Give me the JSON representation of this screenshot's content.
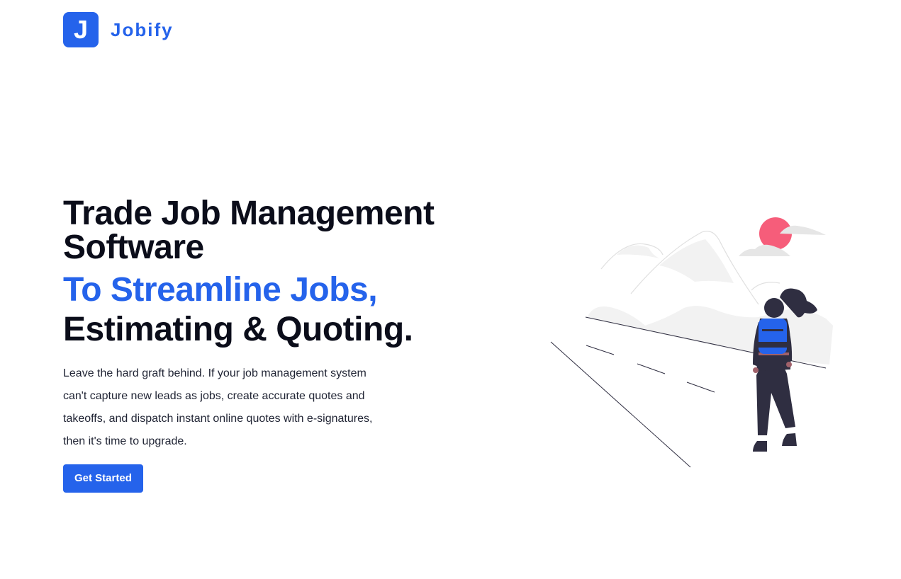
{
  "brand": {
    "logo_letter": "J",
    "name": "Jobify",
    "color": "#2563eb"
  },
  "hero": {
    "title": "Trade Job Management Software",
    "accent": "To Streamline Jobs,",
    "subline": "Estimating & Quoting.",
    "description": "Leave the hard graft behind. If your job management system can't capture new leads as jobs, create accurate quotes and takeoffs, and dispatch instant online quotes with e-signatures, then it's time to upgrade.",
    "cta_label": "Get Started"
  },
  "illustration": {
    "icon": "hiker-mountains-illustration",
    "colors": {
      "sun": "#f65d7a",
      "backpack": "#2563eb",
      "figure": "#2f2e41",
      "mountains": "#f2f2f2"
    }
  }
}
